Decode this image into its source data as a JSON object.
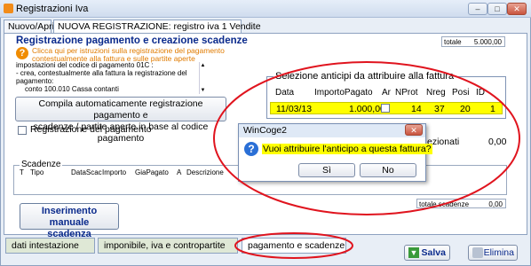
{
  "window": {
    "title": "Registrazioni Iva"
  },
  "tabs": {
    "nuovo_apri": "Nuovo/Apri",
    "nuova_registrazione": "NUOVA REGISTRAZIONE: registro iva 1 Vendite"
  },
  "section": {
    "title": "Registrazione pagamento e creazione scadenze"
  },
  "help": {
    "line1": "Clicca qui per istruzioni sulla registrazione del pagamento",
    "line2": "contestualmente alla fattura e sulle partite aperte"
  },
  "info": {
    "line1": "impostazioni del codice di pagamento 01C :",
    "line2": "- crea, contestualmente alla fattura la registrazione del",
    "line3": "pagamento:",
    "line4": "conto 100.010 Cassa contanti"
  },
  "totale": {
    "label": "totale",
    "value": "5.000,00"
  },
  "buttons": {
    "compila_line1": "Compila automaticamente registrazione pagamento e",
    "compila_line2": "scadenze / partite aperte in base al codice pagamento",
    "inserimento_line1": "Inserimento manuale",
    "inserimento_line2": "scadenza",
    "salva": "Salva",
    "elimina": "Elimina"
  },
  "registrazione_pagamento": {
    "label": "Registrazione del pagamento"
  },
  "anticipi": {
    "title": "Selezione anticipi da attribuire alla fattura",
    "columns": [
      "Data",
      "ImportoPagato",
      "Ar",
      "NProt",
      "Nreg",
      "Posi",
      "ID"
    ],
    "row": {
      "data": "11/03/13",
      "importo": "1.000,00",
      "nprot": "14",
      "nreg": "37",
      "posi": "20",
      "id": "1"
    }
  },
  "selezionati": {
    "label": "ezionati",
    "value": "0,00"
  },
  "scadenze": {
    "title": "Scadenze",
    "columns": [
      "T",
      "Tipo",
      "DataScac",
      "Importo",
      "GiaPagato",
      "A",
      "Descrizione"
    ],
    "totale_label": "totale scadenze",
    "totale_value": "0,00"
  },
  "dialog": {
    "title": "WinCoge2",
    "message": "Vuoi attribuire l'anticipo a questa fattura?",
    "yes": "Sì",
    "no": "No"
  },
  "bottom_tabs": {
    "dati": "dati intestazione",
    "imponibile": "imponibile, iva e contropartite",
    "pagamento": "pagamento e scadenze"
  },
  "colors": {
    "highlight": "#ffff00",
    "annotation": "#e0141e",
    "title_blue": "#0a2a8c"
  }
}
